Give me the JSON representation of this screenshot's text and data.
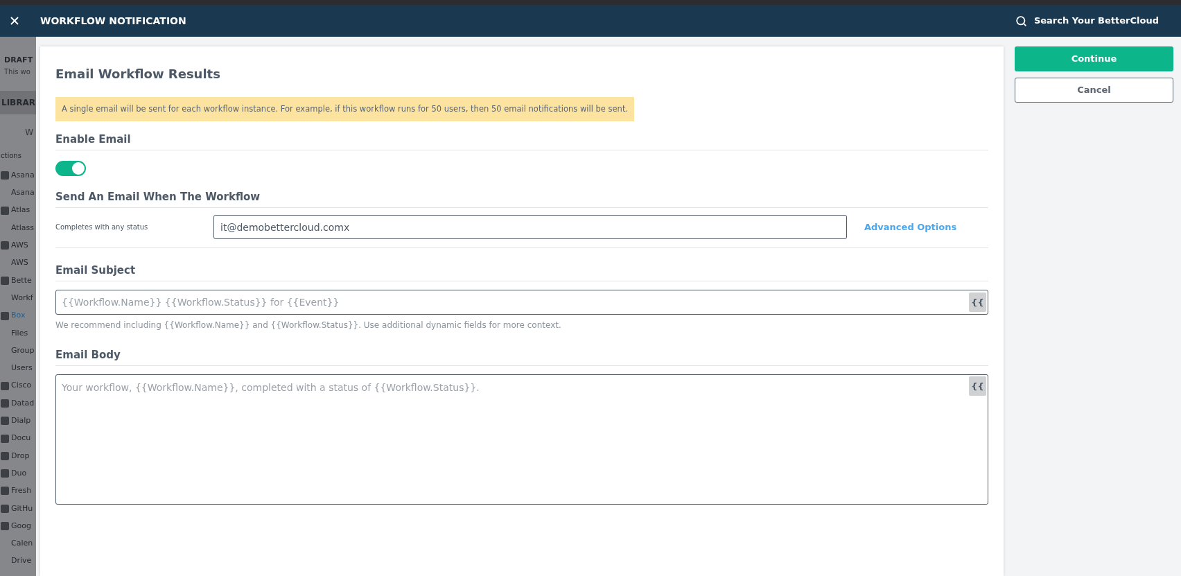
{
  "header": {
    "title": "WORKFLOW NOTIFICATION",
    "search": "Search Your BetterCloud"
  },
  "background_sidebar": {
    "draft_title": "DRAFT",
    "draft_text": "This wo",
    "library_tab": "LIBRAR",
    "tab": "W",
    "section": "ctions",
    "items": [
      {
        "label": "Asana",
        "kind": "app",
        "selected": false
      },
      {
        "label": "Asana",
        "kind": "sub",
        "selected": false
      },
      {
        "label": "Atlas",
        "kind": "app",
        "selected": false
      },
      {
        "label": "Atlass",
        "kind": "sub",
        "selected": false
      },
      {
        "label": "AWS",
        "kind": "app",
        "selected": false
      },
      {
        "label": "AWS",
        "kind": "sub",
        "selected": false
      },
      {
        "label": "Bette",
        "kind": "app",
        "selected": false
      },
      {
        "label": "Workf",
        "kind": "sub",
        "selected": false
      },
      {
        "label": "Box",
        "kind": "app",
        "selected": true
      },
      {
        "label": "Files",
        "kind": "sub",
        "selected": false
      },
      {
        "label": "Group",
        "kind": "sub",
        "selected": false
      },
      {
        "label": "Users",
        "kind": "sub",
        "selected": false
      },
      {
        "label": "Cisco",
        "kind": "app",
        "selected": false
      },
      {
        "label": "Datad",
        "kind": "app",
        "selected": false
      },
      {
        "label": "Dialp",
        "kind": "app",
        "selected": false
      },
      {
        "label": "Docu",
        "kind": "app",
        "selected": false
      },
      {
        "label": "Drop",
        "kind": "app",
        "selected": false
      },
      {
        "label": "Duo",
        "kind": "app",
        "selected": false
      },
      {
        "label": "Fresh",
        "kind": "app",
        "selected": false
      },
      {
        "label": "GitHu",
        "kind": "app",
        "selected": false
      },
      {
        "label": "Goog",
        "kind": "app",
        "selected": false
      },
      {
        "label": "Calen",
        "kind": "sub",
        "selected": false
      },
      {
        "label": "Drive",
        "kind": "sub",
        "selected": false
      }
    ]
  },
  "panel": {
    "title": "Email Workflow Results",
    "notice": "A single email will be sent for each workflow instance. For example, if this workflow runs for 50 users, then 50 email notifications will be sent.",
    "enable_email": {
      "heading": "Enable Email",
      "on": true
    },
    "send_when": {
      "heading": "Send An Email When The Workflow",
      "condition": "Completes with any status",
      "recipient": "it@demobettercloud.comx",
      "advanced_link": "Advanced Options"
    },
    "subject": {
      "heading": "Email Subject",
      "placeholder": "{{Workflow.Name}} {{Workflow.Status}} for {{Event}}",
      "dynamic_button": "{{",
      "hint": "We recommend including {{Workflow.Name}} and {{Workflow.Status}}. Use additional dynamic fields for more context."
    },
    "body": {
      "heading": "Email Body",
      "placeholder": "Your workflow, {{Workflow.Name}}, completed with a status of {{Workflow.Status}}.",
      "dynamic_button": "{{"
    }
  },
  "actions": {
    "continue": "Continue",
    "cancel": "Cancel"
  }
}
